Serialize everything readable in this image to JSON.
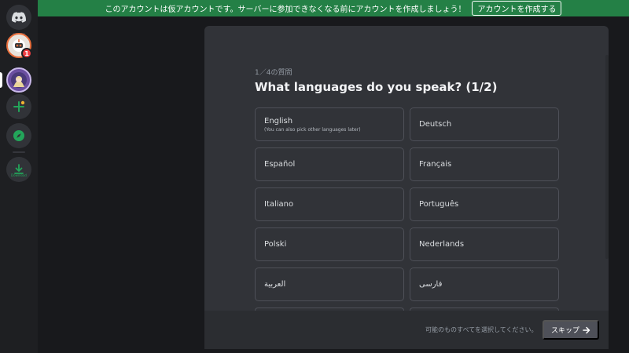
{
  "banner": {
    "text": "このアカウントは仮アカウントです。サーバーに参加できなくなる前にアカウントを作成しましょう！",
    "button_label": "アカウントを作成する"
  },
  "rail": {
    "badge_count": "1",
    "download_label": "Download"
  },
  "modal": {
    "step": "1／4の質問",
    "title": "What languages do you speak? (1/2)",
    "options": [
      {
        "label": "English",
        "sub": "(You can also pick other languages later)"
      },
      {
        "label": "Deutsch"
      },
      {
        "label": "Español"
      },
      {
        "label": "Français"
      },
      {
        "label": "Italiano"
      },
      {
        "label": "Português"
      },
      {
        "label": "Polski"
      },
      {
        "label": "Nederlands"
      },
      {
        "label": "العربية"
      },
      {
        "label": "فارسی"
      }
    ],
    "footer_hint": "可能のものすべてを選択してください。",
    "skip_label": "スキップ"
  },
  "colors": {
    "banner": "#248046",
    "background": "#1e1f22",
    "modal": "#313338",
    "footer": "#2b2d31",
    "option_border": "#4e5058",
    "badge": "#f23f43",
    "green_accent": "#23a55a"
  }
}
